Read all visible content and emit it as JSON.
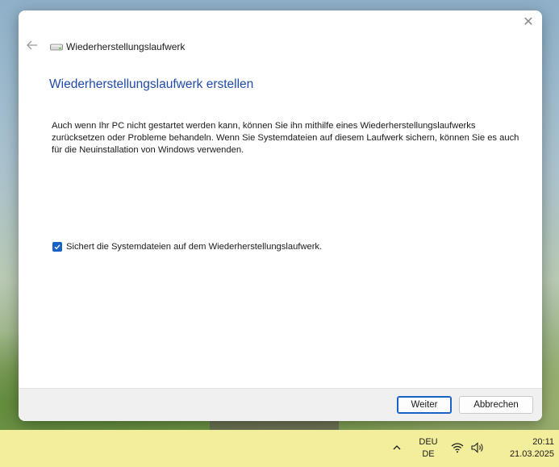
{
  "dialog": {
    "header_title": "Wiederherstellungslaufwerk",
    "heading": "Wiederherstellungslaufwerk erstellen",
    "description": "Auch wenn Ihr PC nicht gestartet werden kann, können Sie ihn mithilfe eines Wiederherstellungslaufwerks zurücksetzen oder Probleme behandeln. Wenn Sie Systemdateien auf diesem Laufwerk sichern, können Sie es auch für die Neuinstallation von Windows verwenden.",
    "checkbox": {
      "label": "Sichert die Systemdateien auf dem Wiederherstellungslaufwerk.",
      "checked": true
    },
    "buttons": {
      "next_label": "Weiter",
      "cancel_label": "Abbrechen"
    },
    "icons": {
      "close": "close-icon",
      "back": "back-arrow-icon",
      "drive": "drive-icon"
    }
  },
  "taskbar": {
    "language_line1": "DEU",
    "language_line2": "DE",
    "time": "20:11",
    "date": "21.03.2025",
    "icons": [
      "chevron-up-icon",
      "wifi-icon",
      "volume-icon"
    ]
  },
  "colors": {
    "accent": "#1a61c6",
    "heading": "#1f4aa8",
    "taskbar": "#f3ee9c"
  }
}
